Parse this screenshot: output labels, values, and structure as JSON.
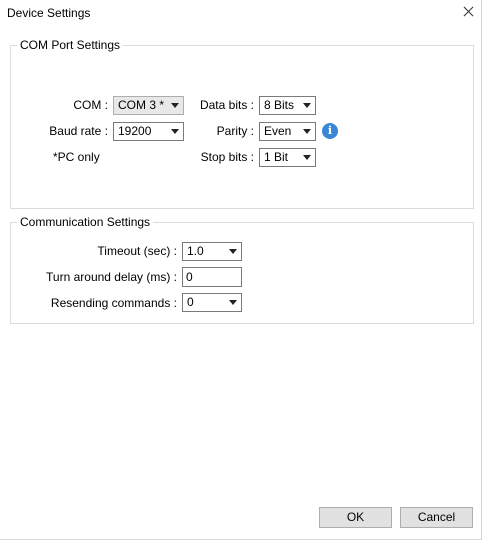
{
  "window": {
    "title": "Device Settings"
  },
  "com_port": {
    "legend": "COM Port Settings",
    "com_label": "COM :",
    "com_value": "COM 3 *",
    "baud_label": "Baud rate :",
    "baud_value": "19200",
    "note": "*PC only",
    "databits_label": "Data bits :",
    "databits_value": "8 Bits",
    "parity_label": "Parity :",
    "parity_value": "Even",
    "stopbits_label": "Stop bits :",
    "stopbits_value": "1 Bit",
    "info_glyph": "i"
  },
  "communication": {
    "legend": "Communication Settings",
    "timeout_label": "Timeout (sec) :",
    "timeout_value": "1.0",
    "turnaround_label": "Turn around delay (ms) :",
    "turnaround_value": "0",
    "resend_label": "Resending commands :",
    "resend_value": "0"
  },
  "buttons": {
    "ok": "OK",
    "cancel": "Cancel"
  },
  "icons": {
    "close": "close-icon",
    "info": "info-icon",
    "dropdown": "chevron-down-icon"
  },
  "colors": {
    "info_blue": "#3b86d6",
    "combo_gray": "#e8e8e8",
    "button_gray": "#e1e1e1"
  }
}
